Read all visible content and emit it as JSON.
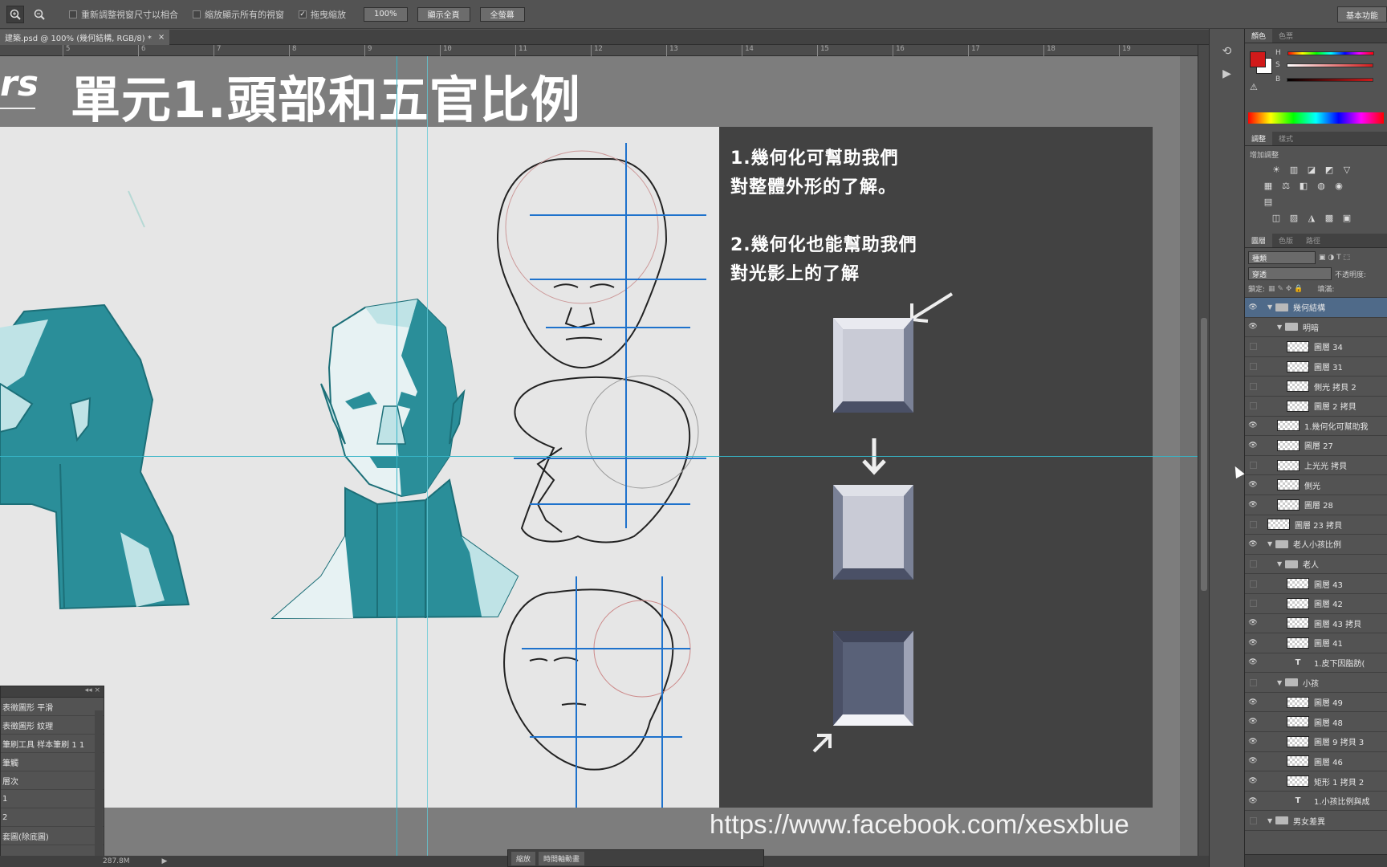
{
  "options_bar": {
    "zoom_in_icon": "zoom-in-icon",
    "zoom_out_icon": "zoom-out-icon",
    "resize_windows_label": "重新調整視窗尺寸以相合",
    "zoom_all_windows_label": "縮放顯示所有的視窗",
    "scrubby_zoom_label": "拖曳縮放",
    "zoom_value": "100%",
    "fit_screen_label": "顯示全頁",
    "fill_screen_label": "全螢幕",
    "workspace_label": "基本功能"
  },
  "document": {
    "tab_title": "建築.psd @ 100% (幾何結構, RGB/8) *",
    "tab_close": "×"
  },
  "ruler": {
    "ticks": [
      "5",
      "6",
      "7",
      "8",
      "9",
      "10",
      "11",
      "12",
      "13",
      "14",
      "15",
      "16",
      "17",
      "18",
      "19"
    ]
  },
  "slide": {
    "title": "單元1.頭部和五官比例",
    "logo": "rs",
    "note1_line1": "1.幾何化可幫助我們",
    "note1_line2": "對整體外形的了解。",
    "note2_line1": "2.幾何化也能幫助我們",
    "note2_line2": "對光影上的了解",
    "url": "https://www.facebook.com/xesxblue"
  },
  "status_bar": {
    "doc_size": "287.8M",
    "arrow": "▶"
  },
  "history_panel": {
    "rows": [
      "表徵圖形 平滑",
      "表徵圖形 紋理",
      "筆刷工具 样本筆刷 1 1",
      "筆觸",
      "層次",
      "1",
      "2",
      "套圖(除底圖)"
    ]
  },
  "float_panel": {
    "tab1": "縮放",
    "tab2": "時間軸動畫"
  },
  "color_panel": {
    "tabs": [
      "顏色",
      "色票"
    ],
    "h_label": "H",
    "s_label": "S",
    "b_label": "B",
    "fg_color": "#d11a1a",
    "bg_color": "#ffffff"
  },
  "adjustments_panel": {
    "tabs": [
      "調整",
      "樣式"
    ],
    "title": "增加調整",
    "icons_row1": [
      "brightness-icon",
      "levels-icon",
      "curves-icon",
      "exposure-icon",
      "vibrance-icon"
    ],
    "icons_row2": [
      "hue-icon",
      "balance-icon",
      "bw-icon",
      "photo-filter-icon",
      "mixer-icon",
      "lookup-icon"
    ],
    "icons_row3": [
      "invert-icon",
      "posterize-icon",
      "threshold-icon",
      "gradient-map-icon",
      "selective-color-icon"
    ]
  },
  "layers_panel": {
    "tabs": [
      "圖層",
      "色版",
      "路徑"
    ],
    "kind_filter": "種類",
    "blend_mode": "穿透",
    "opacity_label": "不透明度:",
    "lock_label": "鎖定:",
    "fill_label": "填滿:",
    "layers": [
      {
        "name": "幾何結構",
        "type": "folder",
        "indent": 0,
        "visible": true,
        "selected": true,
        "expanded": true
      },
      {
        "name": "明暗",
        "type": "folder",
        "indent": 1,
        "visible": true,
        "selected": false,
        "expanded": true
      },
      {
        "name": "圖層 34",
        "type": "layer",
        "indent": 2,
        "visible": false
      },
      {
        "name": "圖層 31",
        "type": "layer",
        "indent": 2,
        "visible": false
      },
      {
        "name": "側光 拷貝 2",
        "type": "layer",
        "indent": 2,
        "visible": false
      },
      {
        "name": "圖層 2 拷貝",
        "type": "layer",
        "indent": 2,
        "visible": false
      },
      {
        "name": "1.幾何化可幫助我",
        "type": "layer",
        "indent": 1,
        "visible": true
      },
      {
        "name": "圖層 27",
        "type": "layer",
        "indent": 1,
        "visible": true
      },
      {
        "name": "上光光 拷貝",
        "type": "layer",
        "indent": 1,
        "visible": false
      },
      {
        "name": "側光",
        "type": "layer",
        "indent": 1,
        "visible": true
      },
      {
        "name": "圖層 28",
        "type": "layer",
        "indent": 1,
        "visible": true
      },
      {
        "name": "圖層 23 拷貝",
        "type": "layer",
        "indent": 0,
        "visible": false
      },
      {
        "name": "老人小孩比例",
        "type": "folder",
        "indent": 0,
        "visible": true,
        "expanded": true
      },
      {
        "name": "老人",
        "type": "folder",
        "indent": 1,
        "visible": false,
        "expanded": true
      },
      {
        "name": "圖層 43",
        "type": "layer",
        "indent": 2,
        "visible": false
      },
      {
        "name": "圖層 42",
        "type": "layer",
        "indent": 2,
        "visible": false
      },
      {
        "name": "圖層 43 拷貝",
        "type": "layer",
        "indent": 2,
        "visible": true
      },
      {
        "name": "圖層 41",
        "type": "layer",
        "indent": 2,
        "visible": true
      },
      {
        "name": "1.皮下因脂肪(",
        "type": "text",
        "indent": 2,
        "visible": true
      },
      {
        "name": "小孩",
        "type": "folder",
        "indent": 1,
        "visible": false,
        "expanded": true
      },
      {
        "name": "圖層 49",
        "type": "layer",
        "indent": 2,
        "visible": true
      },
      {
        "name": "圖層 48",
        "type": "layer",
        "indent": 2,
        "visible": true
      },
      {
        "name": "圖層 9 拷貝 3",
        "type": "layer",
        "indent": 2,
        "visible": true
      },
      {
        "name": "圖層 46",
        "type": "layer",
        "indent": 2,
        "visible": true
      },
      {
        "name": "矩形 1 拷貝 2",
        "type": "layer",
        "indent": 2,
        "visible": true
      },
      {
        "name": "1.小孩比例與成",
        "type": "text",
        "indent": 2,
        "visible": true
      },
      {
        "name": "男女差異",
        "type": "folder",
        "indent": 0,
        "visible": false,
        "expanded": true
      }
    ]
  },
  "colors": {
    "guide": "#36b5c7",
    "teal_head": "#2a8e99",
    "teal_light": "#bfe3e6",
    "bevel_face": "#c9cbd6",
    "bevel_dark": "#596178"
  }
}
